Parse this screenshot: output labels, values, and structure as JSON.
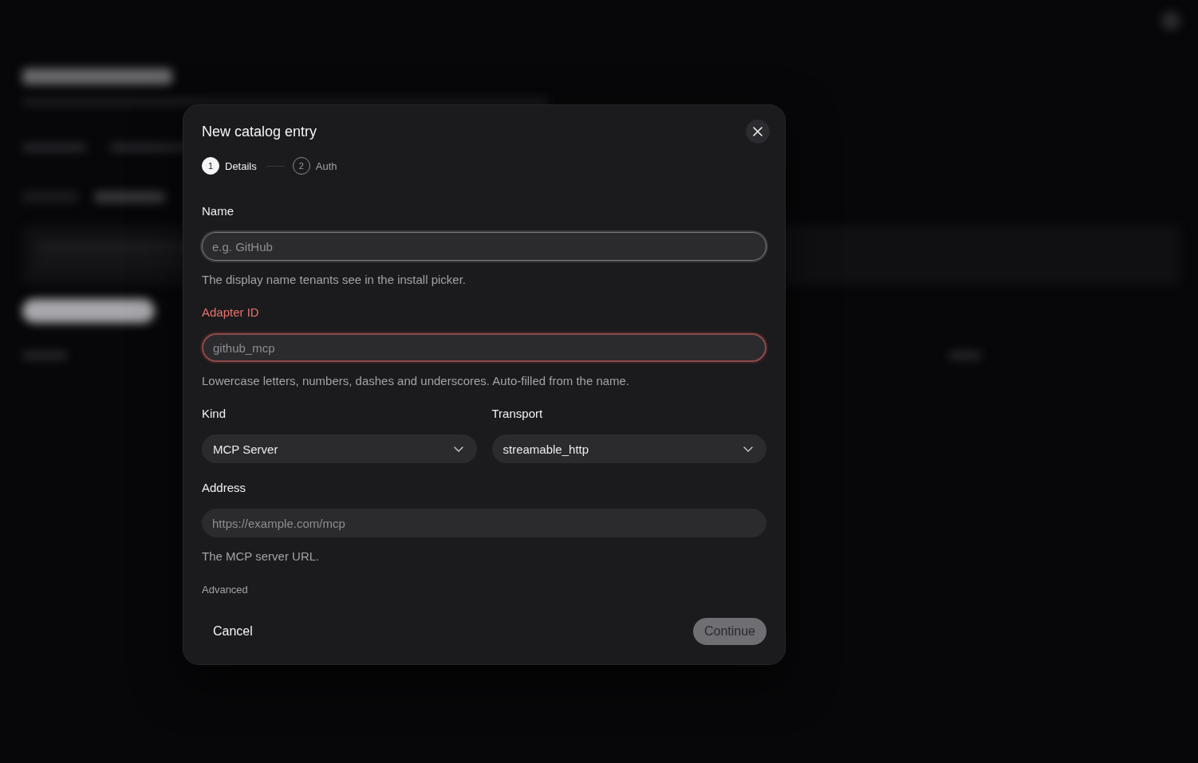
{
  "dialog": {
    "title": "New catalog entry",
    "steps": [
      {
        "number": "1",
        "label": "Details",
        "selected": true
      },
      {
        "number": "2",
        "label": "Auth",
        "selected": false
      }
    ],
    "rows": [
      {
        "kind": "input",
        "label": "Name",
        "placeholder": "e.g. GitHub",
        "focused": true,
        "invalid": false,
        "help": "The display name tenants see in the install picker."
      },
      {
        "kind": "input",
        "label": "Adapter ID",
        "placeholder": "github_mcp",
        "focused": false,
        "invalid": true,
        "help": "Lowercase letters, numbers, dashes and underscores. Auto-filled from the name."
      },
      {
        "kind": "select_pair",
        "selects": [
          {
            "label": "Kind",
            "value": "MCP Server"
          },
          {
            "label": "Transport",
            "value": "streamable_http"
          }
        ]
      },
      {
        "kind": "input",
        "label": "Address",
        "placeholder": "https://example.com/mcp",
        "focused": false,
        "invalid": false,
        "help": "The MCP server URL."
      }
    ],
    "advanced": "Advanced",
    "footer": {
      "cancel": "Cancel",
      "continue": {
        "label": "Continue",
        "disabled": true
      }
    }
  }
}
